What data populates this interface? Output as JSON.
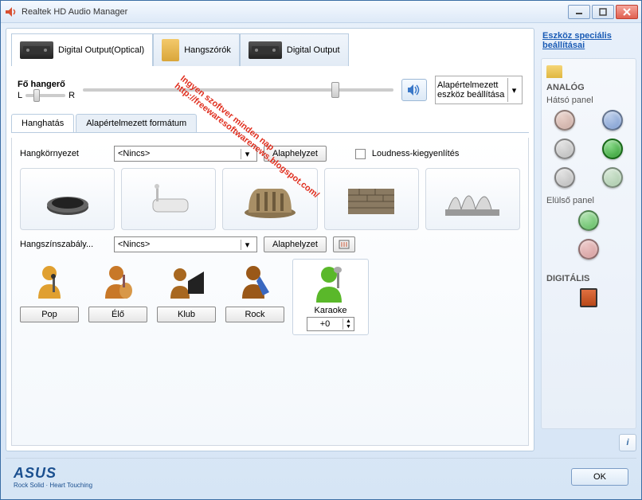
{
  "window": {
    "title": "Realtek HD Audio Manager"
  },
  "tabs": [
    {
      "label": "Digital Output(Optical)"
    },
    {
      "label": "Hangszórók"
    },
    {
      "label": "Digital Output"
    }
  ],
  "volume": {
    "label": "Fő hangerő",
    "left": "L",
    "right": "R"
  },
  "device_select": "Alapértelmezett eszköz beállítása",
  "subtabs": [
    {
      "label": "Hanghatás"
    },
    {
      "label": "Alapértelmezett formátum"
    }
  ],
  "env": {
    "label": "Hangkörnyezet",
    "value": "<Nincs>",
    "reset": "Alaphelyzet"
  },
  "loudness": {
    "label": "Loudness-kiegyenlítés"
  },
  "eq": {
    "label": "Hangszínszabály...",
    "value": "<Nincs>",
    "reset": "Alaphelyzet",
    "presets": [
      "Pop",
      "Élő",
      "Klub",
      "Rock"
    ]
  },
  "karaoke": {
    "label": "Karaoke",
    "value": "+0"
  },
  "side": {
    "link": "Eszköz speciális beállításai",
    "analog": "ANALÓG",
    "back": "Hátsó panel",
    "front": "Elülső panel",
    "digital": "DIGITÁLIS",
    "jacks_back": [
      "#c8a8a0",
      "#7a9ad0",
      "#b8b8b8",
      "#3aa83a",
      "#b8b8b8",
      "#a8c8a8"
    ],
    "jacks_front": [
      "#5ab85a",
      "#d49a9a"
    ],
    "digital_jack": "#d05020"
  },
  "footer": {
    "brand": "ASUS",
    "tagline": "Rock Solid · Heart Touching",
    "ok": "OK"
  },
  "watermark": [
    "Ingyen szoftver minden nap",
    "http://freewaresoftwarenews.blogspot.com/"
  ]
}
